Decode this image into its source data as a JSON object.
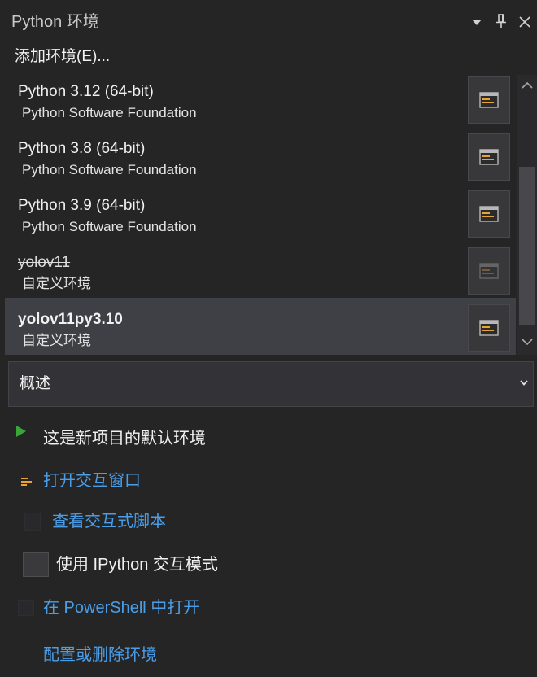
{
  "window": {
    "title": "Python 环境",
    "add_environment_label": "添加环境(E)..."
  },
  "environments": [
    {
      "name": "Python 3.12 (64-bit)",
      "publisher": "Python Software Foundation",
      "selected": false,
      "unavailable": false
    },
    {
      "name": "Python 3.8 (64-bit)",
      "publisher": "Python Software Foundation",
      "selected": false,
      "unavailable": false
    },
    {
      "name": "Python 3.9 (64-bit)",
      "publisher": "Python Software Foundation",
      "selected": false,
      "unavailable": false
    },
    {
      "name": "yolov11",
      "publisher": "自定义环境",
      "selected": false,
      "unavailable": true
    },
    {
      "name": "yolov11py3.10",
      "publisher": "自定义环境",
      "selected": true,
      "unavailable": false
    }
  ],
  "view_selector": {
    "selected": "概述"
  },
  "overview": {
    "default_environment_text": "这是新项目的默认环境",
    "open_interactive_window_link": "打开交互窗口",
    "view_interactive_scripts_link": "查看交互式脚本",
    "ipython_mode": {
      "label": "使用 IPython 交互模式",
      "checked": false
    },
    "open_in_powershell_link": "在 PowerShell 中打开",
    "configure_environment_link": "配置或删除环境"
  },
  "icons": {
    "window_options": "triangle-down-icon",
    "pin": "pin-icon",
    "close": "close-icon",
    "environment_action": "interactive-window-icon",
    "scroll_up": "chevron-up-icon",
    "scroll_down": "chevron-down-icon",
    "view_selector": "chevron-down-icon",
    "default_environment": "play-icon",
    "open_interactive_window": "interactive-window-icon",
    "view_interactive_scripts": "script-icon",
    "open_in_powershell": "powershell-icon"
  },
  "colors": {
    "background": "#252526",
    "panel": "#333337",
    "border": "#434346",
    "selected_row": "#3f3f46",
    "text": "#f1f1f1",
    "muted_text": "#c8c8c8",
    "link": "#4a9ee8",
    "accent_green": "#3aa63a",
    "icon_orange": "#e5a33a"
  }
}
